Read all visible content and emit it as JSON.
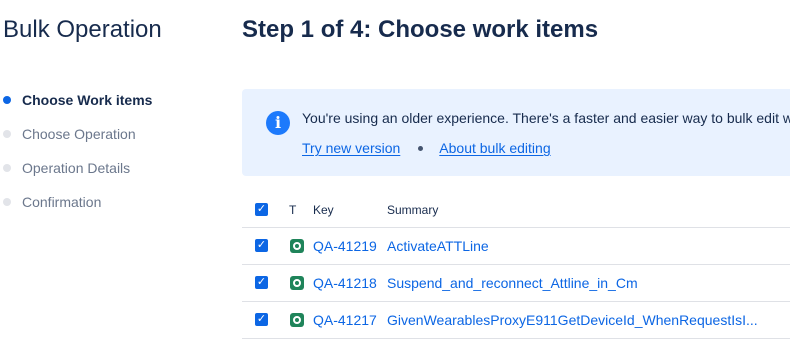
{
  "sidebar": {
    "title": "Bulk Operation",
    "steps": [
      {
        "label": "Choose Work items",
        "state": "active"
      },
      {
        "label": "Choose Operation",
        "state": "pending"
      },
      {
        "label": "Operation Details",
        "state": "pending"
      },
      {
        "label": "Confirmation",
        "state": "pending"
      }
    ]
  },
  "main": {
    "title": "Step 1 of 4: Choose work items",
    "banner": {
      "icon": "info-icon",
      "message": "You're using an older experience. There's a faster and easier way to bulk edit wo",
      "link_try": "Try new version",
      "link_about": "About bulk editing"
    },
    "table": {
      "columns": {
        "type": "T",
        "key": "Key",
        "summary": "Summary"
      },
      "header_checked": true,
      "rows": [
        {
          "key": "QA-41219",
          "summary": "ActivateATTLine",
          "checked": true,
          "type_icon": "test-issue-icon"
        },
        {
          "key": "QA-41218",
          "summary": "Suspend_and_reconnect_Attline_in_Cm",
          "checked": true,
          "type_icon": "test-issue-icon"
        },
        {
          "key": "QA-41217",
          "summary": "GivenWearablesProxyE911GetDeviceId_WhenRequestIsI...",
          "checked": true,
          "type_icon": "test-issue-icon"
        }
      ]
    }
  },
  "colors": {
    "accent": "#0c66e4",
    "banner_bg": "#e9f2ff",
    "type_icon": "#1f845a",
    "inactive_step_dot": "#e2e4e9"
  }
}
